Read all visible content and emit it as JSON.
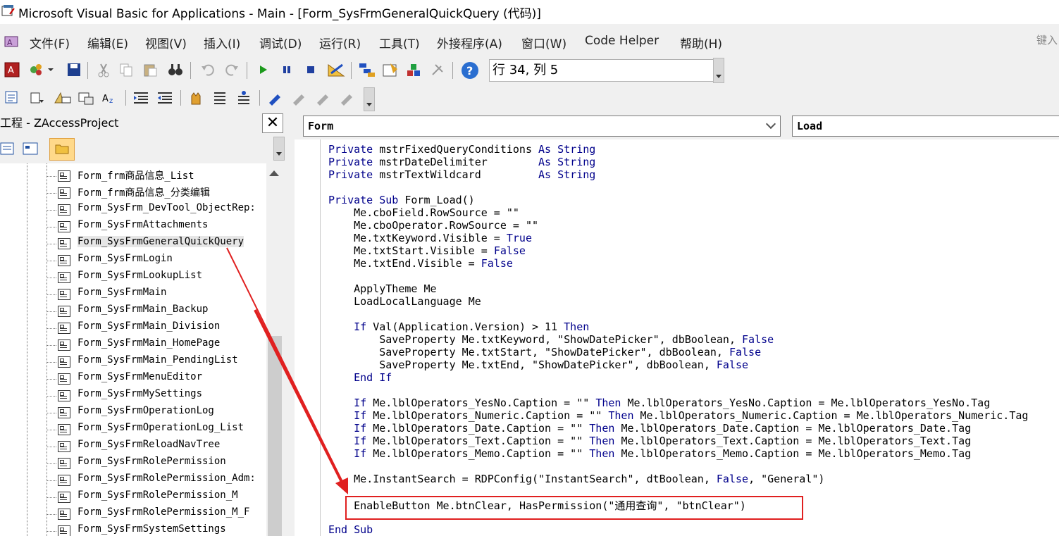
{
  "window": {
    "title": "Microsoft Visual Basic for Applications - Main - [Form_SysFrmGeneralQuickQuery (代码)]"
  },
  "menu": [
    "文件(F)",
    "编辑(E)",
    "视图(V)",
    "插入(I)",
    "调试(D)",
    "运行(R)",
    "工具(T)",
    "外接程序(A)",
    "窗口(W)",
    "Code Helper",
    "帮助(H)"
  ],
  "menu_right_text": "键入",
  "status": {
    "position": "行 34, 列 5"
  },
  "project": {
    "title": "工程 - ZAccessProject",
    "close_label": "✕",
    "items": [
      "Form_frm商品信息_List",
      "Form_frm商品信息_分类编辑",
      "Form_SysFrm_DevTool_ObjectRep:",
      "Form_SysFrmAttachments",
      "Form_SysFrmGeneralQuickQuery",
      "Form_SysFrmLogin",
      "Form_SysFrmLookupList",
      "Form_SysFrmMain",
      "Form_SysFrmMain_Backup",
      "Form_SysFrmMain_Division",
      "Form_SysFrmMain_HomePage",
      "Form_SysFrmMain_PendingList",
      "Form_SysFrmMenuEditor",
      "Form_SysFrmMySettings",
      "Form_SysFrmOperationLog",
      "Form_SysFrmOperationLog_List",
      "Form_SysFrmReloadNavTree",
      "Form_SysFrmRolePermission",
      "Form_SysFrmRolePermission_Adm:",
      "Form_SysFrmRolePermission_M",
      "Form_SysFrmRolePermission_M_F",
      "Form_SysFrmSystemSettings"
    ],
    "selected_index": 4
  },
  "code": {
    "object_combo": "Form",
    "proc_combo": "Load",
    "lines": [
      "Private mstrFixedQueryConditions As String",
      "Private mstrDateDelimiter        As String",
      "Private mstrTextWildcard         As String",
      "",
      "Private Sub Form_Load()",
      "    Me.cboField.RowSource = \"\"",
      "    Me.cboOperator.RowSource = \"\"",
      "    Me.txtKeyword.Visible = True",
      "    Me.txtStart.Visible = False",
      "    Me.txtEnd.Visible = False",
      "",
      "    ApplyTheme Me",
      "    LoadLocalLanguage Me",
      "",
      "    If Val(Application.Version) > 11 Then",
      "        SaveProperty Me.txtKeyword, \"ShowDatePicker\", dbBoolean, False",
      "        SaveProperty Me.txtStart, \"ShowDatePicker\", dbBoolean, False",
      "        SaveProperty Me.txtEnd, \"ShowDatePicker\", dbBoolean, False",
      "    End If",
      "",
      "    If Me.lblOperators_YesNo.Caption = \"\" Then Me.lblOperators_YesNo.Caption = Me.lblOperators_YesNo.Tag",
      "    If Me.lblOperators_Numeric.Caption = \"\" Then Me.lblOperators_Numeric.Caption = Me.lblOperators_Numeric.Tag",
      "    If Me.lblOperators_Date.Caption = \"\" Then Me.lblOperators_Date.Caption = Me.lblOperators_Date.Tag",
      "    If Me.lblOperators_Text.Caption = \"\" Then Me.lblOperators_Text.Caption = Me.lblOperators_Text.Tag",
      "    If Me.lblOperators_Memo.Caption = \"\" Then Me.lblOperators_Memo.Caption = Me.lblOperators_Memo.Tag",
      "",
      "    Me.InstantSearch = RDPConfig(\"InstantSearch\", dtBoolean, False, \"General\")",
      "",
      "    EnableButton Me.btnClear, HasPermission(\"通用查询\", \"btnClear\")",
      "",
      "End Sub"
    ]
  },
  "colors": {
    "keyword": "#00008b",
    "highlight_box": "#e02020",
    "arrow": "#e02020"
  }
}
